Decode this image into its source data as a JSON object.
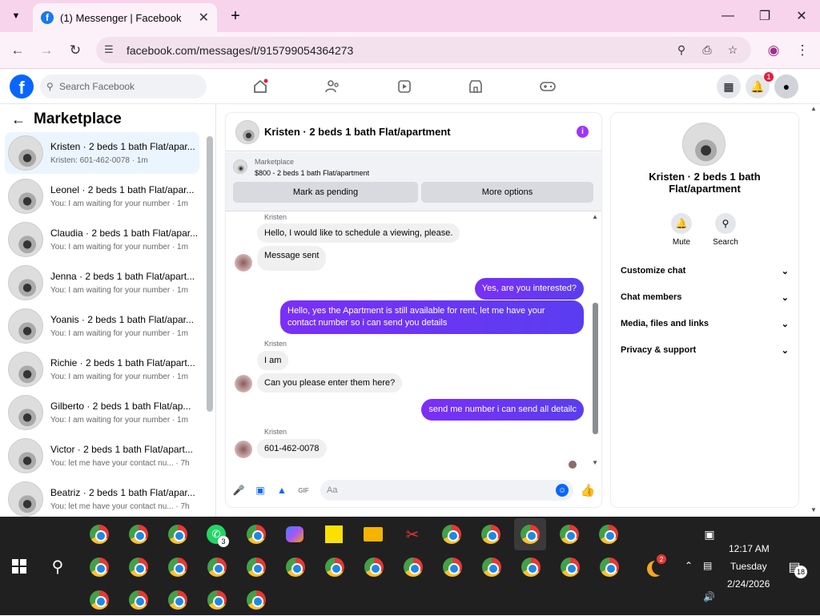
{
  "browser": {
    "tab_title": "(1) Messenger | Facebook",
    "url": "facebook.com/messages/t/915799054364273"
  },
  "fb": {
    "search_placeholder": "Search Facebook",
    "notif_count": "1"
  },
  "sidebar": {
    "title": "Marketplace",
    "conversations": [
      {
        "name": "Kristen · 2 beds 1 bath Flat/apar...",
        "preview": "Kristen: 601-462-0078 · 1m"
      },
      {
        "name": "Leonel · 2 beds 1 bath Flat/apar...",
        "preview": "You: I am waiting for your number · 1m"
      },
      {
        "name": "Claudia · 2 beds 1 bath Flat/apar...",
        "preview": "You: I am waiting for your number · 1m"
      },
      {
        "name": "Jenna · 2 beds 1 bath Flat/apart...",
        "preview": "You: I am waiting for your number · 1m"
      },
      {
        "name": "Yoanis · 2 beds 1 bath Flat/apar...",
        "preview": "You: I am waiting for your number · 1m"
      },
      {
        "name": "Richie · 2 beds 1 bath Flat/apart...",
        "preview": "You: I am waiting for your number · 1m"
      },
      {
        "name": "Gilberto · 2 beds 1 bath Flat/ap...",
        "preview": "You: I am waiting for your number · 1m"
      },
      {
        "name": "Victor · 2 beds 1 bath Flat/apart...",
        "preview": "You: let me have your contact nu... · 7h"
      },
      {
        "name": "Beatriz · 2 beds 1 bath Flat/apar...",
        "preview": "You: let me have your contact nu... · 7h"
      }
    ]
  },
  "chat": {
    "header_name": "Kristen · 2 beds 1 bath Flat/apartment",
    "marketplace_label": "Marketplace",
    "listing": "$800 - 2 beds 1 bath Flat/apartment",
    "mark_pending": "Mark as pending",
    "more_options": "More options",
    "sender": "Kristen",
    "messages": {
      "m1": "Hello, I would like to schedule a viewing, please.",
      "m2": "Message sent",
      "m3": "Yes, are you interested?",
      "m4a": "Hello, yes the Apartment is still available for rent, let me have your",
      "m4b": "contact number so i can send you details",
      "m5": "I am",
      "m6": "Can you please enter them here?",
      "m7": "send me number i can send all detailc",
      "m8": "601-462-0078"
    },
    "input_placeholder": "Aa"
  },
  "details": {
    "name_line1": "Kristen · 2 beds 1 bath",
    "name_line2": "Flat/apartment",
    "mute": "Mute",
    "search": "Search",
    "sections": [
      "Customize chat",
      "Chat members",
      "Media, files and links",
      "Privacy & support"
    ]
  },
  "taskbar": {
    "time": "12:17 AM",
    "day": "Tuesday",
    "date": "2/24/2026",
    "whatsapp_badge": "3",
    "weather_badge": "2",
    "notif_count": "18"
  }
}
